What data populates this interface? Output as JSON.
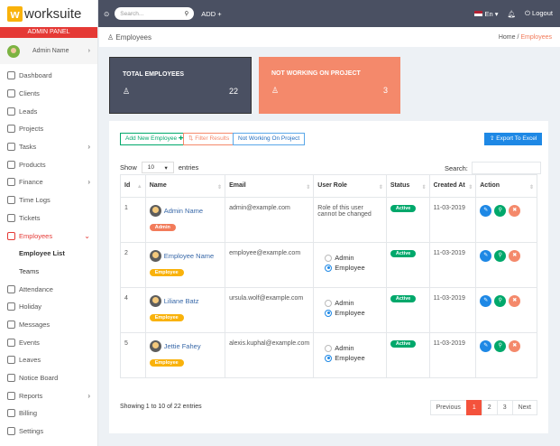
{
  "brand": {
    "logo_letter": "w",
    "name": "worksuite",
    "panel": "ADMIN PANEL"
  },
  "user": {
    "name": "Admin Name"
  },
  "sidebar": {
    "items": [
      {
        "label": "Dashboard",
        "chev": false
      },
      {
        "label": "Clients",
        "chev": false
      },
      {
        "label": "Leads",
        "chev": false
      },
      {
        "label": "Projects",
        "chev": false
      },
      {
        "label": "Tasks",
        "chev": true
      },
      {
        "label": "Products",
        "chev": false
      },
      {
        "label": "Finance",
        "chev": true
      },
      {
        "label": "Time Logs",
        "chev": false
      },
      {
        "label": "Tickets",
        "chev": false
      },
      {
        "label": "Employees",
        "chev": true,
        "active": true
      },
      {
        "label": "Employee List",
        "sub": true,
        "active": true
      },
      {
        "label": "Teams",
        "sub": true
      },
      {
        "label": "Attendance",
        "chev": false
      },
      {
        "label": "Holiday",
        "chev": false
      },
      {
        "label": "Messages",
        "chev": false
      },
      {
        "label": "Events",
        "chev": false
      },
      {
        "label": "Leaves",
        "chev": false
      },
      {
        "label": "Notice Board",
        "chev": false
      },
      {
        "label": "Reports",
        "chev": true
      },
      {
        "label": "Billing",
        "chev": false
      },
      {
        "label": "Settings",
        "chev": false
      }
    ]
  },
  "topbar": {
    "search_placeholder": "Search...",
    "add": "ADD",
    "lang": "En",
    "logout": "Logout"
  },
  "header": {
    "title": "Employees",
    "breadcrumb_home": "Home",
    "breadcrumb_sep": "/",
    "breadcrumb_current": "Employees"
  },
  "cards": [
    {
      "title": "TOTAL EMPLOYEES",
      "value": "22",
      "color": "#4a5062"
    },
    {
      "title": "NOT WORKING ON PROJECT",
      "value": "3",
      "color": "#f4896b"
    }
  ],
  "buttons": {
    "add": "Add New Employee",
    "filter": "Filter Results",
    "not_working": "Not Working On Project",
    "export": "Export To Excel"
  },
  "table_tools": {
    "show": "Show",
    "entries_value": "10",
    "entries": "entries",
    "search": "Search:"
  },
  "table": {
    "headers": [
      "Id",
      "Name",
      "Email",
      "User Role",
      "Status",
      "Created At",
      "Action"
    ],
    "rows": [
      {
        "id": "1",
        "name": "Admin Name",
        "badge": "Admin",
        "email": "admin@example.com",
        "role_text": "Role of this user cannot be changed",
        "status": "Active",
        "created": "11-03-2019"
      },
      {
        "id": "2",
        "name": "Employee Name",
        "badge": "Employee",
        "email": "employee@example.com",
        "status": "Active",
        "created": "11-03-2019"
      },
      {
        "id": "4",
        "name": "Liliane Batz",
        "badge": "Employee",
        "email": "ursula.wolf@example.com",
        "status": "Active",
        "created": "11-03-2019"
      },
      {
        "id": "5",
        "name": "Jettie Fahey",
        "badge": "Employee",
        "email": "alexis.kuphal@example.com",
        "status": "Active",
        "created": "11-03-2019"
      }
    ],
    "role_options": [
      "Admin",
      "Employee"
    ]
  },
  "footer": {
    "info": "Showing 1 to 10 of 22 entries",
    "prev": "Previous",
    "pages": [
      "1",
      "2",
      "3"
    ],
    "next": "Next"
  }
}
